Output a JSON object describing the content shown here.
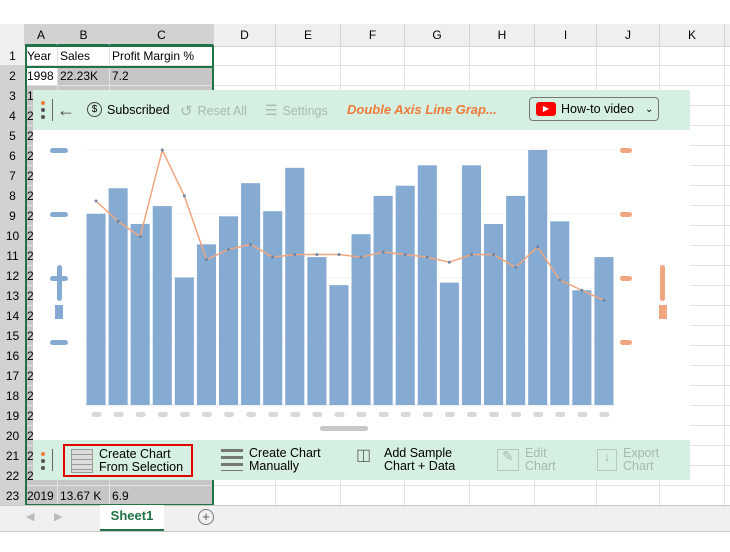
{
  "columns": [
    "A",
    "B",
    "C",
    "D",
    "E",
    "F",
    "G",
    "H",
    "I",
    "J",
    "K"
  ],
  "rows": [
    "1",
    "2",
    "3",
    "4",
    "5",
    "6",
    "7",
    "8",
    "9",
    "10",
    "11",
    "12",
    "13",
    "14",
    "15",
    "16",
    "17",
    "18",
    "19",
    "20",
    "21",
    "22",
    "23"
  ],
  "cells": {
    "r1": [
      "Year",
      "Sales",
      "Profit Margin %"
    ],
    "r2": [
      "1998",
      "22.23K",
      "7.2"
    ],
    "r23": [
      "2019",
      "13.67 K",
      "6.9"
    ],
    "colA_partial": [
      "1",
      "2",
      "2",
      "2",
      "2",
      "2",
      "2",
      "2",
      "2",
      "2",
      "2",
      "2",
      "2",
      "2",
      "2",
      "2",
      "2",
      "2",
      "2",
      "2"
    ]
  },
  "toolbar": {
    "subscribed": "Subscribed",
    "reset_all": "Reset All",
    "settings": "Settings",
    "chart_title": "Double Axis Line Grap...",
    "howto": "How-to video"
  },
  "bottombar": {
    "create_from_selection": [
      "Create Chart",
      "From Selection"
    ],
    "create_manually": [
      "Create Chart",
      "Manually"
    ],
    "add_sample": [
      "Add Sample",
      "Chart + Data"
    ],
    "edit_chart": [
      "Edit",
      "Chart"
    ],
    "export_chart": [
      "Export",
      "Chart"
    ]
  },
  "sheet_tab": "Sheet1",
  "colors": {
    "accent_green": "#217346",
    "panel_green": "#d5efe0",
    "bar_blue": "#86abd3",
    "line_orange": "#f0a57e",
    "title_orange": "#f07a3a",
    "highlight_red": "#e00000"
  },
  "chart_data": {
    "type": "bar+line",
    "note_placeholder_labels": "",
    "bars": [
      0.75,
      0.85,
      0.71,
      0.78,
      0.5,
      0.63,
      0.74,
      0.87,
      0.76,
      0.93,
      0.58,
      0.47,
      0.67,
      0.82,
      0.86,
      0.94,
      0.48,
      0.94,
      0.71,
      0.82,
      1.0,
      0.72,
      0.45,
      0.58
    ],
    "line": [
      0.8,
      0.72,
      0.66,
      1.0,
      0.82,
      0.57,
      0.61,
      0.63,
      0.58,
      0.59,
      0.59,
      0.59,
      0.58,
      0.6,
      0.59,
      0.58,
      0.56,
      0.59,
      0.59,
      0.54,
      0.62,
      0.49,
      0.45,
      0.41
    ],
    "ylim": [
      0,
      1
    ],
    "grid": true
  }
}
